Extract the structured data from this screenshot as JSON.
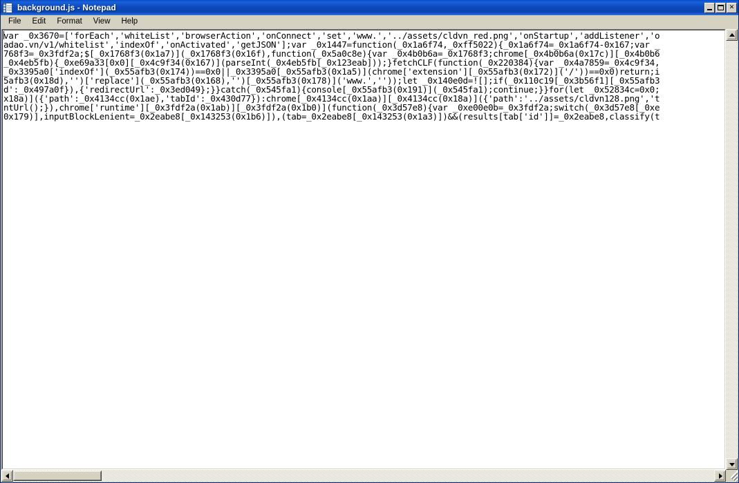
{
  "window": {
    "title": "background.js - Notepad",
    "icon": "notepad-icon",
    "controls": {
      "minimize_label": "_",
      "maximize_label": "□",
      "close_label": "✕"
    }
  },
  "menubar": {
    "items": [
      {
        "label": "File"
      },
      {
        "label": "Edit"
      },
      {
        "label": "Format"
      },
      {
        "label": "View"
      },
      {
        "label": "Help"
      }
    ]
  },
  "editor": {
    "filename": "background.js",
    "wrap": true,
    "lines": [
      "var _0x3670=['forEach','whiteList','browserAction','onConnect','set','www.','../assets/cldvn_red.png','onStartup','addListener','o",
      "adao.vn/v1/whitelist','indexOf','onActivated','getJSON'];var _0x1447=function(_0x1a6f74,_0xff5022){_0x1a6f74=_0x1a6f74-0x167;var _",
      "768f3=_0x3fdf2a;$[_0x1768f3(0x1a7)](_0x1768f3(0x16f),function(_0x5a0c8e){var _0x4b0b6a=_0x1768f3;chrome[_0x4b0b6a(0x17c)][_0x4b0b6",
      "_0x4eb5fb){_0xe69a33[0x0][_0x4c9f34(0x167)](parseInt(_0x4eb5fb[_0x123eab]));}fetchCLF(function(_0x220384){var _0x4a7859=_0x4c9f34,",
      "_0x3395a0['indexOf'](_0x55afb3(0x174))==0x0||_0x3395a0[_0x55afb3(0x1a5)](chrome['extension'][_0x55afb3(0x172)]('/'))==0x0)return;i",
      "5afb3(0x18d),'')['replace'](_0x55afb3(0x168),'')[_0x55afb3(0x178)]('www.',''));let _0x140e0d=![];if(_0x110c19[_0x3b56f1][_0x55afb3",
      "d':_0x497a0f}),{'redirectUrl':_0x3ed049};}}catch(_0x545fa1){console[_0x55afb3(0x191)](_0x545fa1);continue;}}for(let _0x52834c=0x0;",
      "x18a)]({'path':_0x4134cc(0x1ae),'tabId':_0x430d77}):chrome[_0x4134cc(0x1aa)][_0x4134cc(0x18a)]({'path':'../assets/cldvn128.png','t",
      "ntUrl();}),chrome['runtime'][_0x3fdf2a(0x1ab)][_0x3fdf2a(0x1b0)](function(_0x3d57e8){var _0xe00e0b=_0x3fdf2a;switch(_0x3d57e8[_0xe",
      "0x179)],inputBlockLenient=_0x2eabe8[_0x143253(0x1b6)]),(tab=_0x2eabe8[_0x143253(0x1a3)])&&(results[tab['id']]=_0x2eabe8,classify(t"
    ]
  },
  "scrollbars": {
    "vertical": {
      "up_arrow": "scroll-up-arrow",
      "down_arrow": "scroll-down-arrow",
      "thumb_visible": false
    },
    "horizontal": {
      "left_arrow": "scroll-left-arrow",
      "right_arrow": "scroll-right-arrow",
      "thumb_visible": true
    }
  },
  "colors": {
    "title_active": "#0a4cc4",
    "window_face": "#d6d2c2",
    "editor_bg": "#ffffff",
    "editor_fg": "#000000"
  }
}
